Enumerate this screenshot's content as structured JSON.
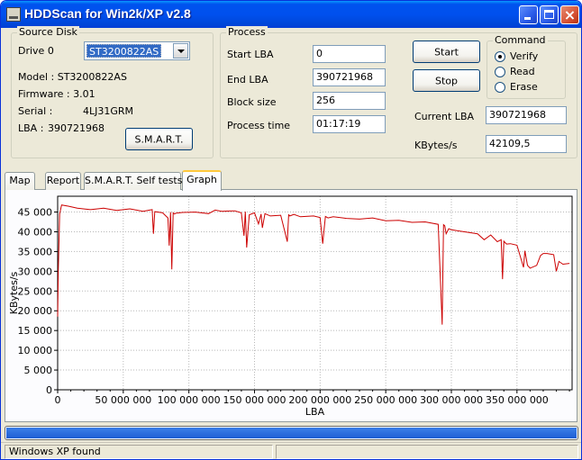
{
  "window": {
    "title": "HDDScan for Win2k/XP  v2.8",
    "close_glyph": "×"
  },
  "source": {
    "legend": "Source Disk",
    "drive_label": "Drive  0",
    "drive_value": "ST3200822AS",
    "model": "Model : ST3200822AS",
    "firmware": "Firmware : 3.01",
    "serial_label": "Serial :",
    "serial_value": "4LJ31GRM",
    "lba_label": "LBA :",
    "lba_value": "390721968",
    "smart_button": "S.M.A.R.T."
  },
  "process": {
    "legend": "Process",
    "start_lba_label": "Start LBA",
    "start_lba": "0",
    "end_lba_label": "End LBA",
    "end_lba": "390721968",
    "block_size_label": "Block size",
    "block_size": "256",
    "process_time_label": "Process time",
    "process_time": "01:17:19",
    "start_button": "Start",
    "stop_button": "Stop",
    "current_lba_label": "Current LBA",
    "current_lba": "390721968",
    "kbytes_label": "KBytes/s",
    "kbytes": "42109,5"
  },
  "command": {
    "legend": "Command",
    "options": [
      {
        "label": "Verify",
        "selected": true
      },
      {
        "label": "Read",
        "selected": false
      },
      {
        "label": "Erase",
        "selected": false
      }
    ]
  },
  "tabs": [
    {
      "label": "Map",
      "active": false
    },
    {
      "label": "Report",
      "active": false
    },
    {
      "label": "S.M.A.R.T. Self tests",
      "active": false
    },
    {
      "label": "Graph",
      "active": true
    }
  ],
  "progress": {
    "value": 1.0,
    "color": "#316ac5"
  },
  "status": {
    "text": "Windows XP found"
  },
  "chart_data": {
    "type": "line",
    "title": "",
    "xlabel": "LBA",
    "ylabel": "KBytes/s",
    "xlim": [
      0,
      392000000
    ],
    "ylim": [
      0,
      49000
    ],
    "grid": true,
    "x_ticks": [
      0,
      50000000,
      100000000,
      150000000,
      200000000,
      250000000,
      300000000,
      350000000
    ],
    "x_tick_labels": [
      "0",
      "50 000 000",
      "100 000 000",
      "150 000 000",
      "200 000 000",
      "250 000 000",
      "300 000 000",
      "350 000 000"
    ],
    "y_ticks": [
      0,
      5000,
      10000,
      15000,
      20000,
      25000,
      30000,
      35000,
      40000,
      45000
    ],
    "y_tick_labels": [
      "0",
      "5 000",
      "10 000",
      "15 000",
      "20 000",
      "25 000",
      "30 000",
      "35 000",
      "40 000",
      "45 000"
    ],
    "series": [
      {
        "color": "#cc0000",
        "x": [
          0,
          500000,
          1500000,
          3000000,
          8000000,
          15000000,
          25000000,
          35000000,
          45000000,
          55000000,
          65000000,
          72000000,
          73000000,
          74000000,
          80000000,
          84000000,
          85000000,
          86000000,
          87000000,
          88000000,
          89000000,
          90000000,
          95000000,
          105000000,
          115000000,
          120000000,
          125000000,
          135000000,
          140000000,
          142000000,
          143000000,
          144000000,
          146000000,
          150000000,
          153000000,
          155000000,
          156000000,
          158000000,
          162000000,
          170000000,
          175000000,
          176000000,
          177000000,
          180000000,
          185000000,
          195000000,
          200000000,
          202000000,
          204000000,
          206000000,
          210000000,
          220000000,
          230000000,
          240000000,
          250000000,
          260000000,
          270000000,
          280000000,
          290000000,
          293000000,
          294000000,
          295000000,
          296000000,
          298000000,
          300000000,
          310000000,
          320000000,
          325000000,
          330000000,
          335000000,
          338000000,
          339000000,
          340000000,
          342000000,
          345000000,
          350000000,
          355000000,
          356000000,
          358000000,
          360000000,
          365000000,
          368000000,
          370000000,
          373000000,
          378000000,
          380000000,
          382000000,
          385000000,
          390000000
        ],
        "y": [
          18500,
          30000,
          44500,
          46800,
          46500,
          46000,
          45600,
          46000,
          45400,
          45800,
          45200,
          45600,
          39500,
          45100,
          44800,
          43500,
          36500,
          45000,
          30500,
          44800,
          44500,
          44700,
          44900,
          45000,
          44600,
          45500,
          45200,
          45300,
          44800,
          39000,
          45100,
          36000,
          44300,
          44800,
          42000,
          44500,
          41000,
          44600,
          44000,
          44200,
          37500,
          44300,
          44000,
          44400,
          43800,
          44000,
          43600,
          37000,
          43900,
          43500,
          43800,
          43400,
          43200,
          43500,
          42800,
          42900,
          42400,
          42500,
          41900,
          16500,
          41800,
          41500,
          39500,
          40800,
          40500,
          40000,
          39500,
          38000,
          39200,
          37500,
          38000,
          28000,
          37600,
          36900,
          37000,
          36600,
          31000,
          35200,
          31500,
          30800,
          31500,
          34000,
          34500,
          34500,
          34200,
          30000,
          32500,
          31800,
          32000
        ]
      }
    ]
  }
}
